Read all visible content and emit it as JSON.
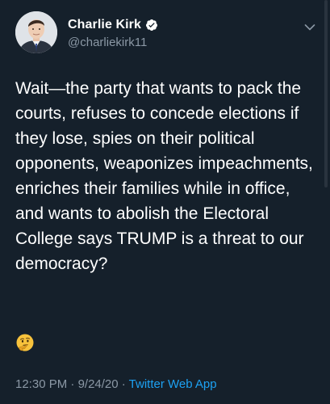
{
  "tweet": {
    "author": {
      "display_name": "Charlie Kirk",
      "handle": "@charliekirk11",
      "verified": true
    },
    "text": "Wait—the party that wants to pack the courts, refuses to concede elections if they lose, spies on their political opponents, weaponizes impeachments, enriches their families while in office, and wants to abolish the Electoral College says TRUMP is a threat to our democracy?",
    "emoji": "thinking-face",
    "meta": {
      "time": "12:30 PM",
      "separator": " · ",
      "date": "9/24/20",
      "source": "Twitter Web App"
    }
  },
  "colors": {
    "background": "#15202b",
    "text": "#ffffff",
    "secondary_text": "#8b98a5",
    "link": "#1da1f2",
    "verified_badge": "#ffffff"
  }
}
